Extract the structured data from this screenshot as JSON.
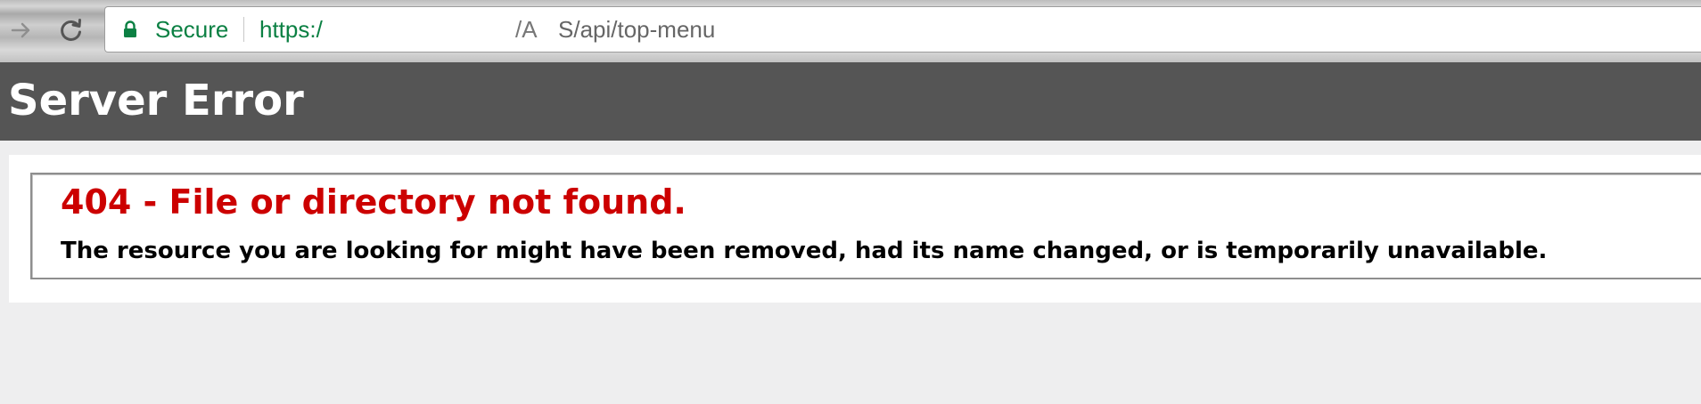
{
  "browser": {
    "forward_icon": "arrow-right-icon",
    "reload_icon": "reload-icon",
    "lock_icon": "lock-icon",
    "secure_label": "Secure",
    "url_scheme": "https:/",
    "url_fragment": "/A",
    "url_path": "S/api/top-menu",
    "secure_color": "#0b8043"
  },
  "header": {
    "title": "Server Error",
    "background": "#555555"
  },
  "error": {
    "title": "404 - File or directory not found.",
    "description": "The resource you are looking for might have been removed, had its name changed, or is temporarily unavailable.",
    "title_color": "#cc0000"
  }
}
